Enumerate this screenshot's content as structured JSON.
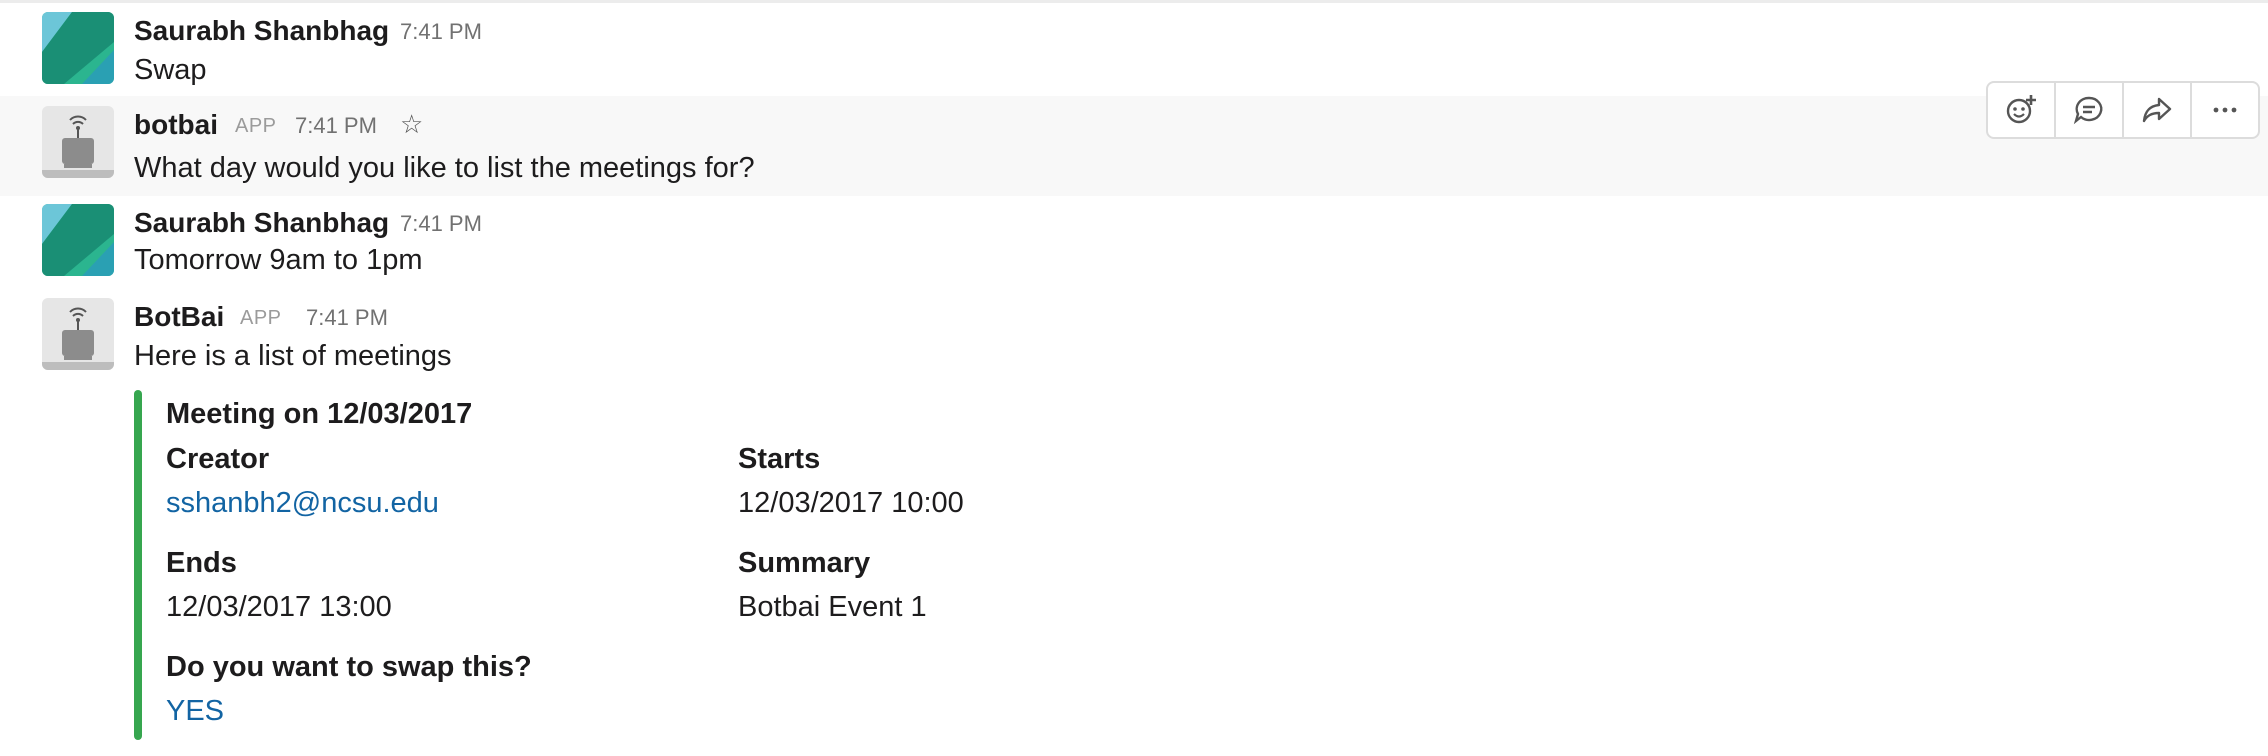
{
  "messages": [
    {
      "author": "Saurabh Shanbhag",
      "time": "7:41 PM",
      "text": "Swap"
    },
    {
      "author": "botbai",
      "badge": "APP",
      "time": "7:41 PM",
      "text": "What day would you like to list the meetings for?"
    },
    {
      "author": "Saurabh Shanbhag",
      "time": "7:41 PM",
      "text": "Tomorrow 9am to 1pm"
    },
    {
      "author": "BotBai",
      "badge": "APP",
      "time": "7:41 PM",
      "text": "Here is a list of meetings"
    }
  ],
  "message_actions": [
    {
      "icon": "add-reaction-icon"
    },
    {
      "icon": "start-thread-icon"
    },
    {
      "icon": "share-message-icon"
    },
    {
      "icon": "more-actions-icon"
    }
  ],
  "attachment": {
    "title": "Meeting on 12/03/2017",
    "accent_color": "#36a64f",
    "fields": [
      {
        "label": "Creator",
        "value": "sshanbh2@ncsu.edu"
      },
      {
        "label": "Starts",
        "value": "12/03/2017 10:00"
      },
      {
        "label": "Ends",
        "value": "12/03/2017 13:00"
      },
      {
        "label": "Summary",
        "value": "Botbai Event 1"
      },
      {
        "label": "Do you want to swap this?",
        "value": "YES"
      }
    ]
  },
  "colors": {
    "link": "#1264a3",
    "hover_bg": "#f8f8f8"
  }
}
